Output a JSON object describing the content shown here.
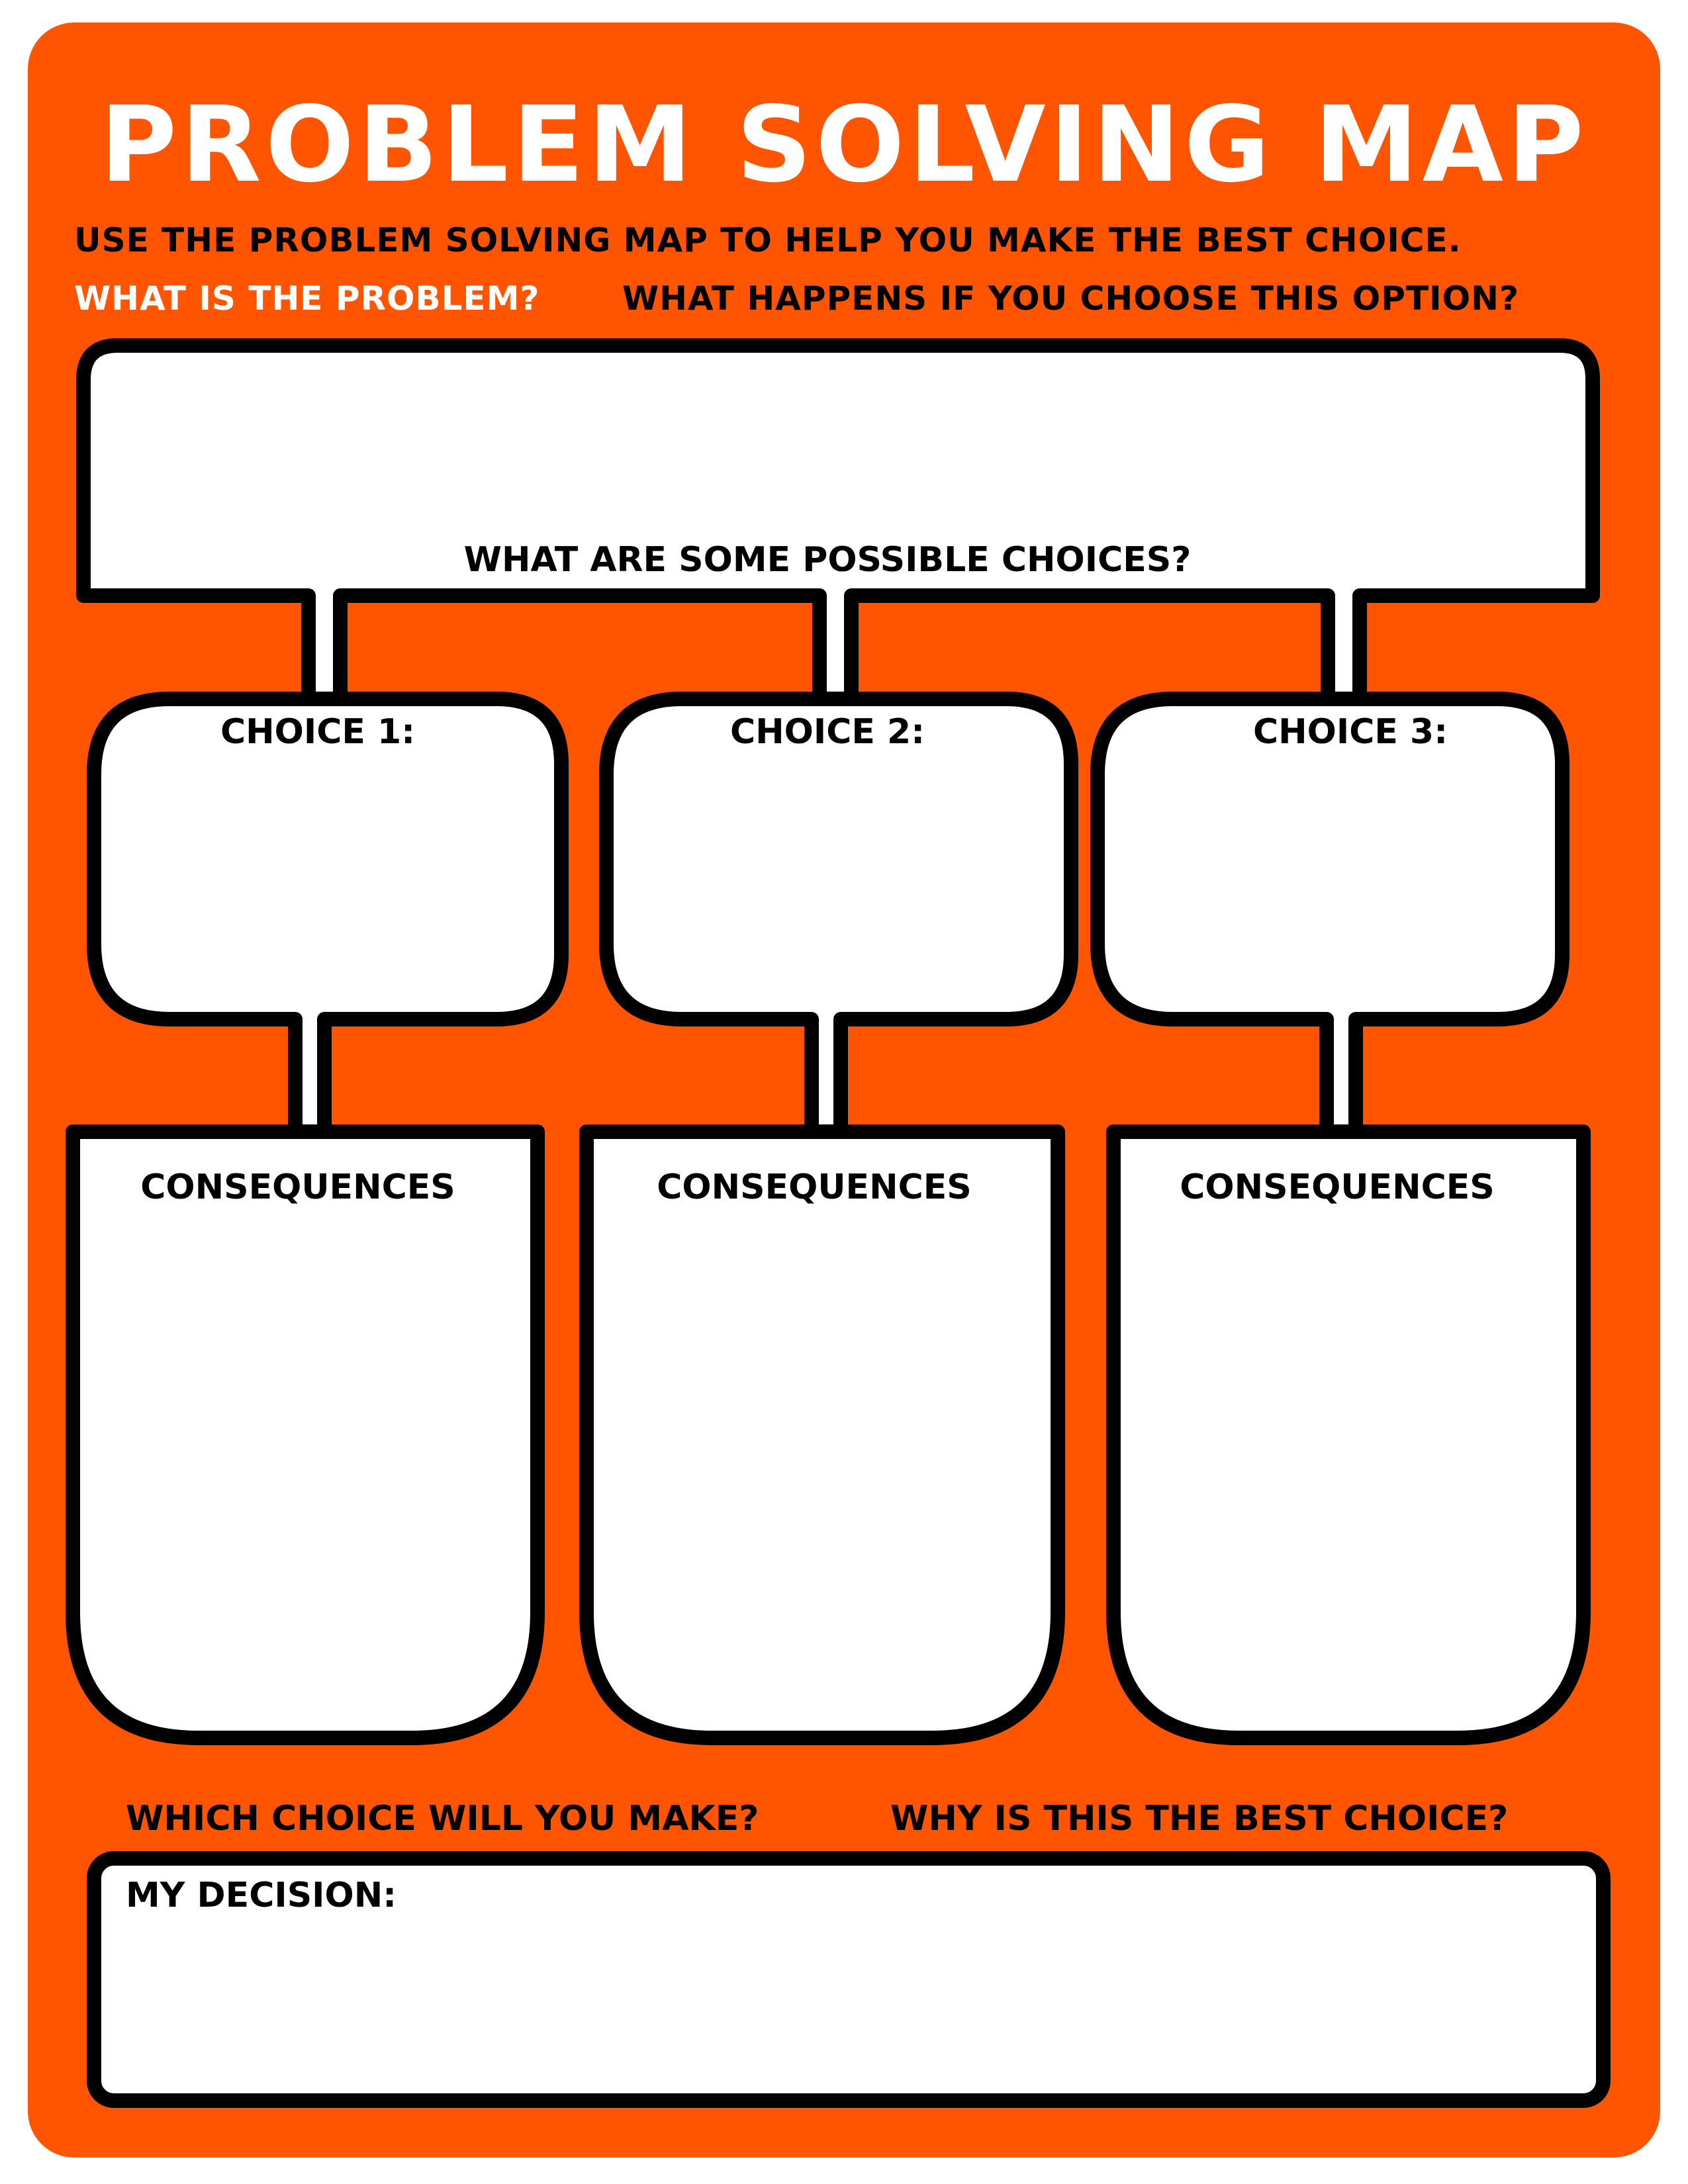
{
  "colors": {
    "background": "#ff5500",
    "box_fill": "#ffffff",
    "outline": "#000000",
    "title_text": "#ffffff",
    "highlight_text": "#ffffff",
    "body_text": "#000000"
  },
  "page": {
    "title": "PROBLEM SOLVING MAP",
    "instruction": "USE THE PROBLEM SOLVING MAP TO HELP YOU MAKE THE BEST CHOICE.",
    "problem_prompt": "WHAT IS THE PROBLEM?",
    "option_prompt": "WHAT HAPPENS IF YOU CHOOSE THIS OPTION?",
    "choices_prompt": "WHAT ARE SOME POSSIBLE CHOICES?",
    "choices": [
      {
        "label": "CHOICE 1:",
        "consequences_label": "CONSEQUENCES"
      },
      {
        "label": "CHOICE 2:",
        "consequences_label": "CONSEQUENCES"
      },
      {
        "label": "CHOICE 3:",
        "consequences_label": "CONSEQUENCES"
      }
    ],
    "which_choice_prompt": "WHICH CHOICE WILL YOU MAKE?",
    "why_prompt": "WHY IS THIS THE BEST CHOICE?",
    "decision_label": "MY DECISION:"
  }
}
